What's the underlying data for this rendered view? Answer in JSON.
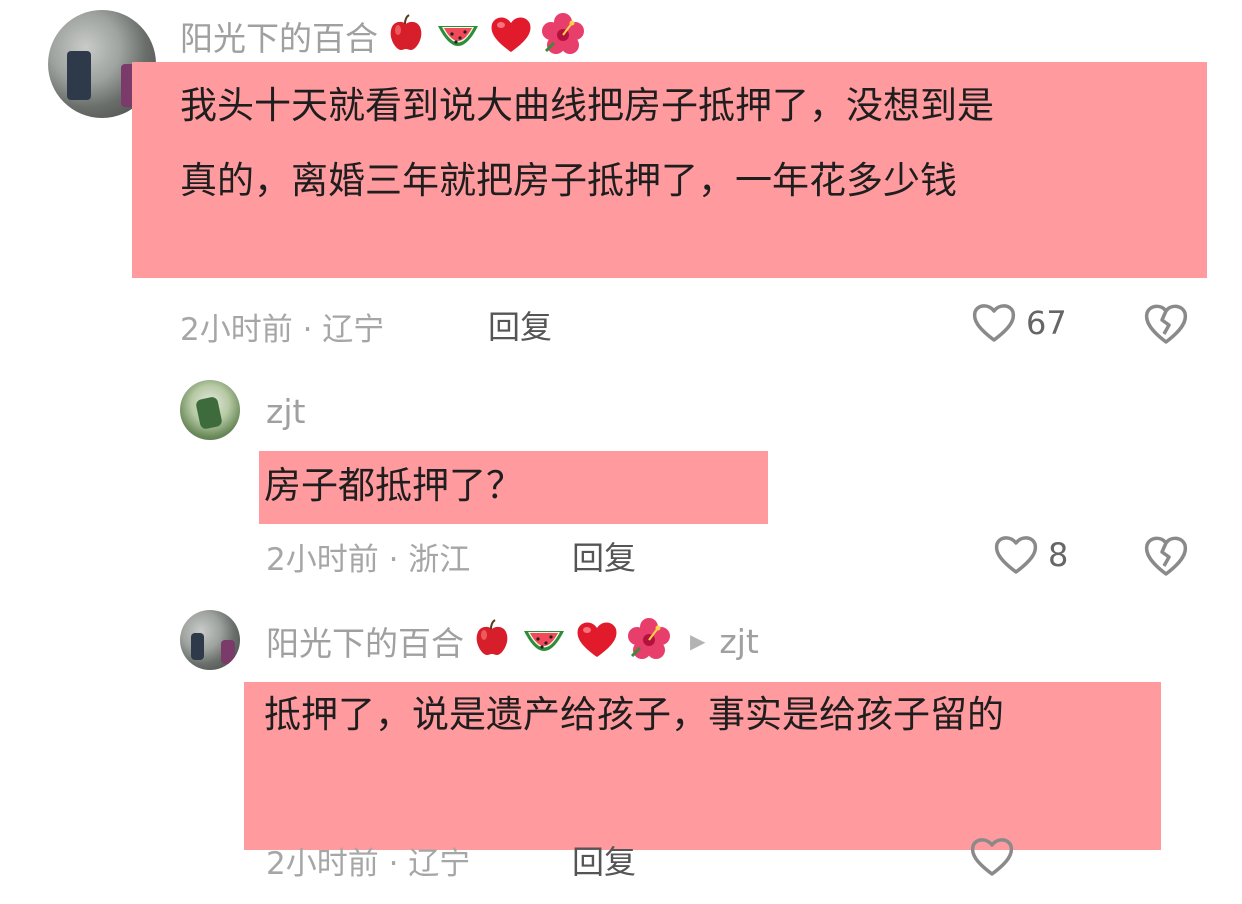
{
  "comments": [
    {
      "username": "阳光下的百合",
      "emojis": [
        "apple-emoji",
        "watermelon-emoji",
        "heart-emoji",
        "hibiscus-emoji"
      ],
      "text_line1": "我头十天就看到说大曲线把房子抵押了，没想到是",
      "text_line2": "真的，离婚三年就把房子抵押了，一年花多少钱",
      "meta": "2小时前 · 辽宁",
      "reply_label": "回复",
      "likes": "67"
    },
    {
      "username": "zjt",
      "text_line1": "房子都抵押了？",
      "meta": "2小时前 · 浙江",
      "reply_label": "回复",
      "likes": "8"
    },
    {
      "username": "阳光下的百合",
      "emojis": [
        "apple-emoji",
        "watermelon-emoji",
        "heart-emoji",
        "hibiscus-emoji"
      ],
      "reply_to": "zjt",
      "text_line1": "抵押了，说是遗产给孩子，事实是给孩子留的",
      "meta": "2小时前 · 辽宁",
      "reply_label": "回复"
    }
  ],
  "colors": {
    "highlight": "#ff9a9e",
    "muted_text": "#a0a0a0"
  }
}
